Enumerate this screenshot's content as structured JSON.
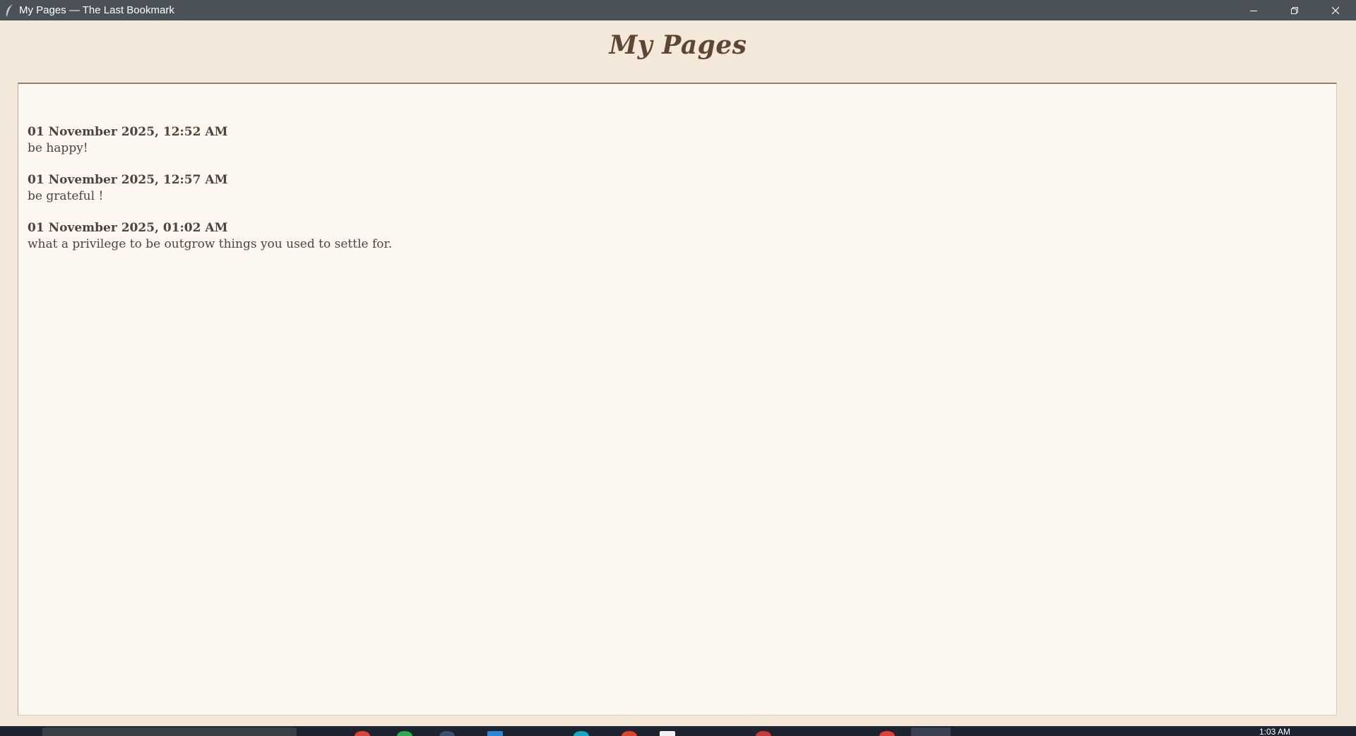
{
  "window": {
    "title": "My Pages — The Last Bookmark",
    "app_icon": "quill-feather-icon",
    "controls": [
      "minimize-icon",
      "restore-icon",
      "close-icon"
    ]
  },
  "page": {
    "heading": "My Pages"
  },
  "entries": [
    {
      "date": "01 November 2025, 12:52 AM",
      "text": "be happy!"
    },
    {
      "date": "01 November 2025, 12:57 AM",
      "text": "be grateful !"
    },
    {
      "date": "01 November 2025, 01:02 AM",
      "text": "what a privilege to be outgrow things you used to settle for."
    }
  ],
  "taskbar": {
    "clock_partial": "1:03 AM"
  },
  "colors": {
    "titlebar": "#4a5258",
    "window_background": "#f3e8da",
    "panel_background": "#fcf7f0",
    "heading_text": "#5e4632",
    "entry_text": "#4e4438",
    "taskbar": "#1d2430"
  }
}
